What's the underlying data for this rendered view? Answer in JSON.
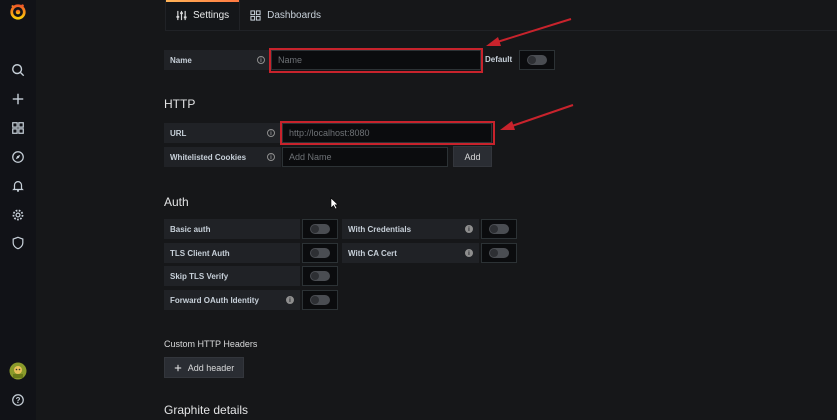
{
  "sidebar": {
    "icons": [
      "grafana-logo-icon",
      "search-icon",
      "plus-icon",
      "dashboards-grid-icon",
      "explore-compass-icon",
      "alerting-bell-icon",
      "configuration-gear-icon",
      "shield-icon",
      "user-avatar-icon",
      "help-icon"
    ]
  },
  "tabs": [
    {
      "label": "Settings",
      "icon": "sliders-icon",
      "active": true
    },
    {
      "label": "Dashboards",
      "icon": "grid-icon",
      "active": false
    }
  ],
  "name_row": {
    "label": "Name",
    "placeholder": "Name",
    "default_label": "Default"
  },
  "http": {
    "title": "HTTP",
    "url_label": "URL",
    "url_value": "http://localhost:8080",
    "cookies_label": "Whitelisted Cookies",
    "cookies_placeholder": "Add Name",
    "add_label": "Add"
  },
  "auth": {
    "title": "Auth",
    "basic_auth": "Basic auth",
    "with_credentials": "With Credentials",
    "tls_client_auth": "TLS Client Auth",
    "with_ca_cert": "With CA Cert",
    "skip_tls_verify": "Skip TLS Verify",
    "forward_oauth": "Forward OAuth Identity"
  },
  "custom_headers": {
    "title": "Custom HTTP Headers",
    "add_header": "Add header"
  },
  "graphite": {
    "title": "Graphite details"
  },
  "colors": {
    "annotation": "#c8232c",
    "accent_orange": "#ff7941"
  }
}
